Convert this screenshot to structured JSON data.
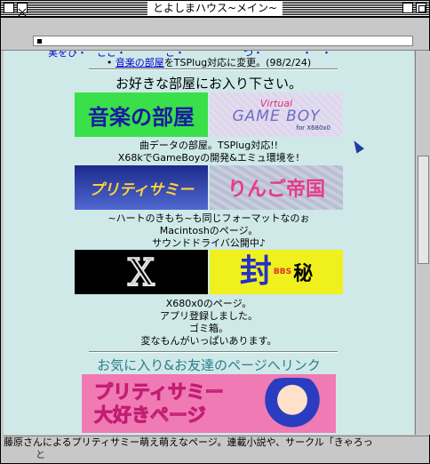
{
  "window": {
    "title": "とよしまハウス~メイン~"
  },
  "content": {
    "top_cut_text": "実をひ・　ここ・　　　　こ・　　　　　　つ・　　　　・　・　　　　　　　",
    "news": {
      "link_text": "音楽の部屋",
      "middle_text": "をTSPlug対応に変更。",
      "date": "(98/2/24)"
    },
    "welcome": "お好きな部屋にお入り下さい。",
    "banners": {
      "music": "音楽の部屋",
      "virtual_gameboy_1": "Virtual",
      "virtual_gameboy_2": "GAME BOY",
      "virtual_gameboy_3": "for X680x0",
      "pretty_sammy": "プリティサミー",
      "ringo": "りんご帝国",
      "x680": "X",
      "fuuhi": "封",
      "fuuhi_b": "秘",
      "bbs": "BBS"
    },
    "captions": {
      "c1_line1": "曲データの部屋。TSPlug対応!!",
      "c1_line2": "X68kでGameBoyの開発&エミュ環境を!",
      "c2_line1": "~ハートのきもち~も同じフォーマットなのぉ",
      "c2_line2": "Macintoshのページ。",
      "c2_line3": "サウンドドライバ公開中♪",
      "c3_line1": "X680x0のページ。",
      "c3_line2": "アプリ登録しました。",
      "c3_line3": "ゴミ箱。",
      "c3_line4": "変なもんがいっぱいあります。"
    },
    "section_title": "お気に入り&お友達のページへリンク",
    "fav_banner_line1": "プリティサミー",
    "fav_banner_line2": "大好きページ"
  },
  "status": {
    "line1": "藤原さんによるプリティサミー萌え萌えなページ。連載小説や、サークル「きゃろっ",
    "line2": "と　　　　　　　　　　　　　　　　　　　　　　　　　　"
  },
  "colors": {
    "background": "#cfe9e9",
    "link": "#0000cc"
  }
}
